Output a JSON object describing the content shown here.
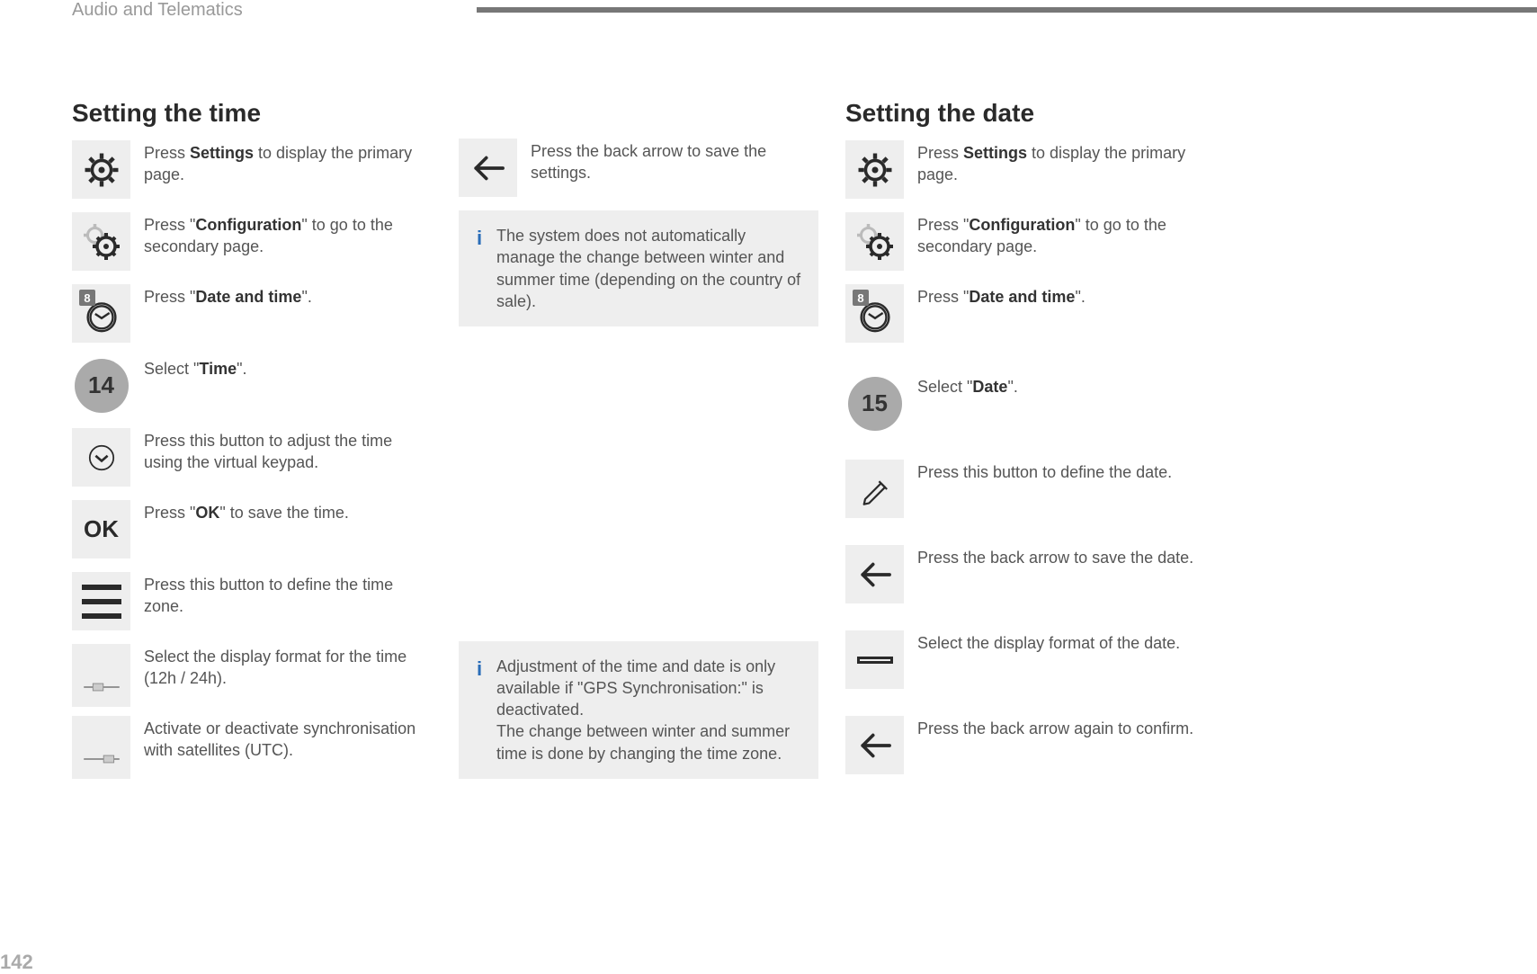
{
  "header_title": "Audio and Telematics",
  "page_number": "142",
  "badge8": "8",
  "col1": {
    "heading": "Setting the time",
    "s1": {
      "pre": "Press ",
      "bold": "Settings",
      "post": " to display the primary page."
    },
    "s2": {
      "pre": "Press \"",
      "bold": "Configuration",
      "post": "\" to go to the secondary page."
    },
    "s3": {
      "pre": "Press \"",
      "bold": "Date and time",
      "post": "\"."
    },
    "s4": {
      "num": "14",
      "pre": "Select \"",
      "bold": "Time",
      "post": "\"."
    },
    "s5": "Press this button to adjust the time using the virtual keypad.",
    "s6": {
      "pre": "Press \"",
      "bold": "OK",
      "post": "\" to save the time.",
      "ok": "OK"
    },
    "s7": "Press this button to define the time zone.",
    "s8": "Select the display format for the time (12h / 24h).",
    "s9": "Activate or deactivate synchronisation with satellites (UTC)."
  },
  "col2": {
    "s1": "Press the back arrow to save the settings.",
    "note1": "The system does not automatically manage the change between winter and summer time (depending on the country of sale).",
    "note2a": "Adjustment of the time and date is only available if \"GPS Synchronisation:\" is deactivated.",
    "note2b": "The change between winter and summer time is done by changing the time zone."
  },
  "col3": {
    "heading": "Setting the date",
    "s1": {
      "pre": "Press ",
      "bold": "Settings",
      "post": " to display the primary page."
    },
    "s2": {
      "pre": "Press \"",
      "bold": "Configuration",
      "post": "\" to go to the secondary page."
    },
    "s3": {
      "pre": "Press \"",
      "bold": "Date and time",
      "post": "\"."
    },
    "s4": {
      "num": "15",
      "pre": "Select \"",
      "bold": "Date",
      "post": "\"."
    },
    "s5": "Press this button to define the date.",
    "s6": "Press the back arrow to save the date.",
    "s7": "Select the display format of the date.",
    "s8": "Press the back arrow again to confirm."
  }
}
